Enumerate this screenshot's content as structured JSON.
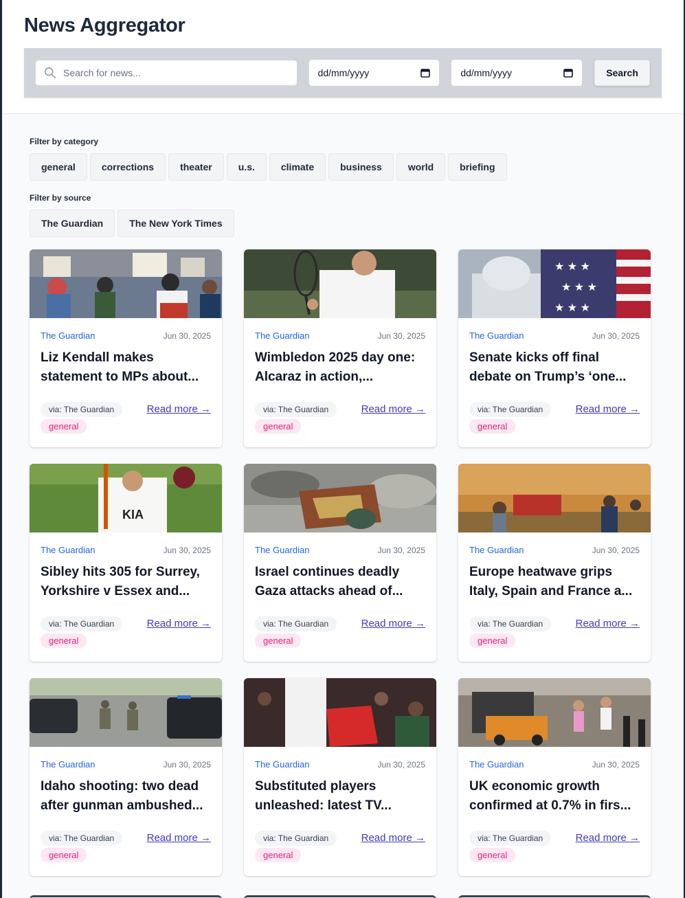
{
  "app": {
    "title": "News Aggregator"
  },
  "search": {
    "placeholder": "Search for news...",
    "from_date_placeholder": "dd/mm/yyyy",
    "to_date_placeholder": "dd/mm/yyyy",
    "button_label": "Search"
  },
  "filters": {
    "category_label": "Filter by category",
    "categories": [
      "general",
      "corrections",
      "theater",
      "u.s.",
      "climate",
      "business",
      "world",
      "briefing"
    ],
    "source_label": "Filter by source",
    "sources": [
      "The Guardian",
      "The New York Times"
    ]
  },
  "articles": [
    {
      "source": "The Guardian",
      "date": "Jun 30, 2025",
      "title": "Liz Kendall makes statement to MPs about...",
      "via": "via: The Guardian",
      "read_more": "Read more →",
      "category": "general",
      "image": "protest-crowd-photo"
    },
    {
      "source": "The Guardian",
      "date": "Jun 30, 2025",
      "title": "Wimbledon 2025 day one: Alcaraz in action,...",
      "via": "via: The Guardian",
      "read_more": "Read more →",
      "category": "general",
      "image": "tennis-player-photo"
    },
    {
      "source": "The Guardian",
      "date": "Jun 30, 2025",
      "title": "Senate kicks off final debate on Trump’s ‘one...",
      "via": "via: The Guardian",
      "read_more": "Read more →",
      "category": "general",
      "image": "capitol-flag-photo"
    },
    {
      "source": "The Guardian",
      "date": "Jun 30, 2025",
      "title": "Sibley hits 305 for Surrey, Yorkshire v Essex and...",
      "via": "via: The Guardian",
      "read_more": "Read more →",
      "category": "general",
      "image": "cricketer-photo"
    },
    {
      "source": "The Guardian",
      "date": "Jun 30, 2025",
      "title": "Israel continues deadly Gaza attacks ahead of...",
      "via": "via: The Guardian",
      "read_more": "Read more →",
      "category": "general",
      "image": "rubble-photo"
    },
    {
      "source": "The Guardian",
      "date": "Jun 30, 2025",
      "title": "Europe heatwave grips Italy, Spain and France a...",
      "via": "via: The Guardian",
      "read_more": "Read more →",
      "category": "general",
      "image": "wildfire-photo"
    },
    {
      "source": "The Guardian",
      "date": "Jun 30, 2025",
      "title": "Idaho shooting: two dead after gunman ambushed...",
      "via": "via: The Guardian",
      "read_more": "Read more →",
      "category": "general",
      "image": "police-scene-photo"
    },
    {
      "source": "The Guardian",
      "date": "Jun 30, 2025",
      "title": "Substituted players unleashed: latest TV...",
      "via": "via: The Guardian",
      "read_more": "Read more →",
      "category": "general",
      "image": "football-crowd-photo"
    },
    {
      "source": "The Guardian",
      "date": "Jun 30, 2025",
      "title": "UK economic growth confirmed at 0.7% in firs...",
      "via": "via: The Guardian",
      "read_more": "Read more →",
      "category": "general",
      "image": "london-street-photo"
    }
  ],
  "colors": {
    "source_link": "#2563eb",
    "read_more": "#4338ca",
    "category_badge_bg": "#fce7f3",
    "category_badge_text": "#db2777",
    "search_panel_bg": "#d1d5db"
  }
}
